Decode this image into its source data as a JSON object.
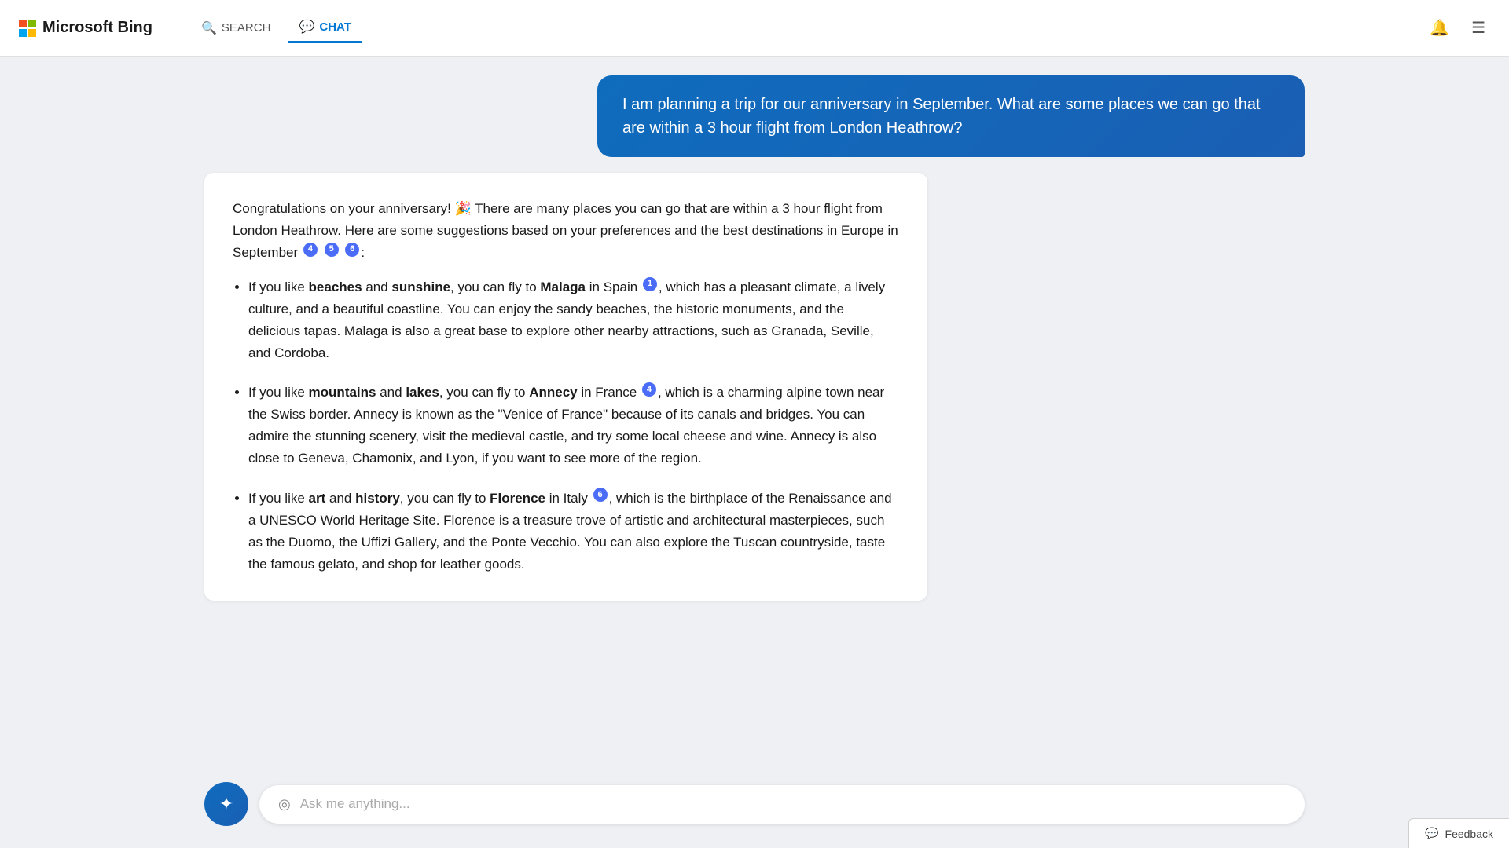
{
  "header": {
    "logo_text": "Microsoft Bing",
    "nav_search_label": "SEARCH",
    "nav_chat_label": "CHAT"
  },
  "user_message": {
    "text": "I am planning a trip for our anniversary in September. What are some places we can go that are within a 3 hour flight from London Heathrow?"
  },
  "ai_response": {
    "intro": "Congratulations on your anniversary! 🎉 There are many places you can go that are within a 3 hour flight from London Heathrow. Here are some suggestions based on your preferences and the best destinations in Europe in September",
    "intro_citations": [
      "4",
      "5",
      "6"
    ],
    "items": [
      {
        "bold_parts": [
          "beaches",
          "sunshine",
          "Malaga"
        ],
        "citation": "1",
        "text": "If you like beaches and sunshine, you can fly to Malaga in Spain",
        "rest": ", which has a pleasant climate, a lively culture, and a beautiful coastline. You can enjoy the sandy beaches, the historic monuments, and the delicious tapas. Malaga is also a great base to explore other nearby attractions, such as Granada, Seville, and Cordoba."
      },
      {
        "citation": "4",
        "text": "If you like mountains and lakes, you can fly to Annecy in France",
        "rest": ", which is a charming alpine town near the Swiss border. Annecy is known as the “Venice of France” because of its canals and bridges. You can admire the stunning scenery, visit the medieval castle, and try some local cheese and wine. Annecy is also close to Geneva, Chamonix, and Lyon, if you want to see more of the region."
      },
      {
        "citation": "6",
        "text": "If you like art and history, you can fly to Florence in Italy",
        "rest": ", which is the birthplace of the Renaissance and a UNESCO World Heritage Site. Florence is a treasure trove of artistic and architectural masterpieces, such as the Duomo, the Uffizi Gallery, and the Ponte Vecchio. You can also explore the Tuscan countryside, taste the famous gelato, and shop for leather goods."
      }
    ]
  },
  "input": {
    "placeholder": "Ask me anything..."
  },
  "feedback": {
    "label": "Feedback"
  }
}
